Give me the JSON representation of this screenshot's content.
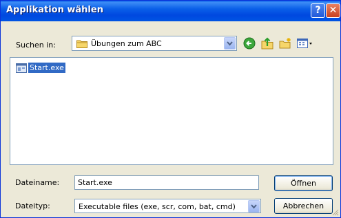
{
  "window": {
    "title": "Applikation wählen",
    "help_glyph": "?",
    "close_glyph": "✕"
  },
  "lookin": {
    "label": "Suchen in:",
    "value": "Übungen zum ABC"
  },
  "toolbar": {
    "icons": [
      "back-icon",
      "up-folder-icon",
      "new-folder-icon",
      "view-menu-icon"
    ]
  },
  "filelist": {
    "items": [
      {
        "label": "Start.exe",
        "icon": "executable-icon",
        "selected": true
      }
    ]
  },
  "filename": {
    "label": "Dateiname:",
    "value": "Start.exe"
  },
  "filetype": {
    "label": "Dateityp:",
    "value": "Executable files (exe, scr, com, bat, cmd)"
  },
  "buttons": {
    "open_label": "Öffnen",
    "cancel_label": "Abbrechen"
  },
  "colors": {
    "titlebar": "#0a5fe8",
    "selection": "#316ac5",
    "dialog_bg": "#ece9d8"
  }
}
